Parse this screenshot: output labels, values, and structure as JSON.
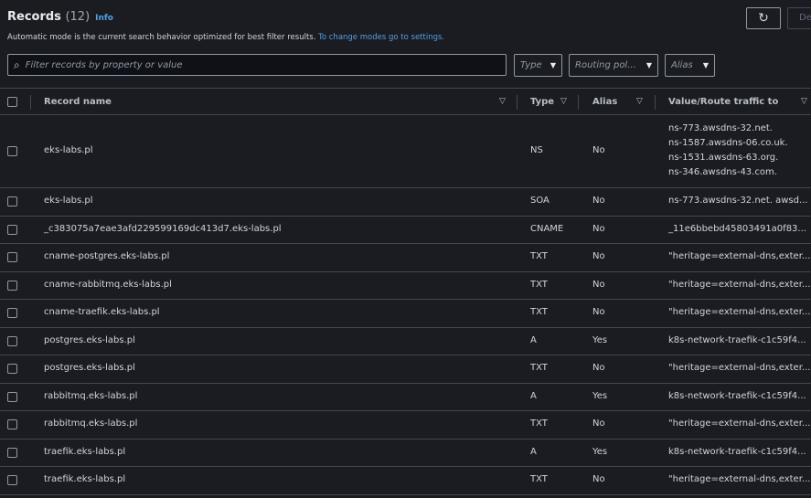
{
  "header": {
    "title": "Records",
    "count": "(12)",
    "info": "Info",
    "description": "Automatic mode is the current search behavior optimized for best filter results.",
    "description_link": "To change modes go to settings.",
    "refresh_icon": "refresh-icon",
    "delete_label": "De"
  },
  "filters": {
    "search_placeholder": "Filter records by property or value",
    "type": "Type",
    "routing": "Routing pol...",
    "alias": "Alias"
  },
  "columns": [
    "Record name",
    "Type",
    "Alias",
    "Value/Route traffic to"
  ],
  "rows": [
    {
      "name": "eks-labs.pl",
      "type": "NS",
      "alias": "No",
      "values": [
        "ns-773.awsdns-32.net.",
        "ns-1587.awsdns-06.co.uk.",
        "ns-1531.awsdns-63.org.",
        "ns-346.awsdns-43.com."
      ]
    },
    {
      "name": "eks-labs.pl",
      "type": "SOA",
      "alias": "No",
      "values": [
        "ns-773.awsdns-32.net. awsd..."
      ]
    },
    {
      "name": "_c383075a7eae3afd229599169dc413d7.eks-labs.pl",
      "type": "CNAME",
      "alias": "No",
      "values": [
        "_11e6bbebd45803491a0f83..."
      ]
    },
    {
      "name": "cname-postgres.eks-labs.pl",
      "type": "TXT",
      "alias": "No",
      "values": [
        "\"heritage=external-dns,exter..."
      ]
    },
    {
      "name": "cname-rabbitmq.eks-labs.pl",
      "type": "TXT",
      "alias": "No",
      "values": [
        "\"heritage=external-dns,exter..."
      ]
    },
    {
      "name": "cname-traefik.eks-labs.pl",
      "type": "TXT",
      "alias": "No",
      "values": [
        "\"heritage=external-dns,exter..."
      ]
    },
    {
      "name": "postgres.eks-labs.pl",
      "type": "A",
      "alias": "Yes",
      "values": [
        "k8s-network-traefik-c1c59f4..."
      ]
    },
    {
      "name": "postgres.eks-labs.pl",
      "type": "TXT",
      "alias": "No",
      "values": [
        "\"heritage=external-dns,exter..."
      ]
    },
    {
      "name": "rabbitmq.eks-labs.pl",
      "type": "A",
      "alias": "Yes",
      "values": [
        "k8s-network-traefik-c1c59f4..."
      ]
    },
    {
      "name": "rabbitmq.eks-labs.pl",
      "type": "TXT",
      "alias": "No",
      "values": [
        "\"heritage=external-dns,exter..."
      ]
    },
    {
      "name": "traefik.eks-labs.pl",
      "type": "A",
      "alias": "Yes",
      "values": [
        "k8s-network-traefik-c1c59f4..."
      ]
    },
    {
      "name": "traefik.eks-labs.pl",
      "type": "TXT",
      "alias": "No",
      "values": [
        "\"heritage=external-dns,exter..."
      ]
    }
  ]
}
